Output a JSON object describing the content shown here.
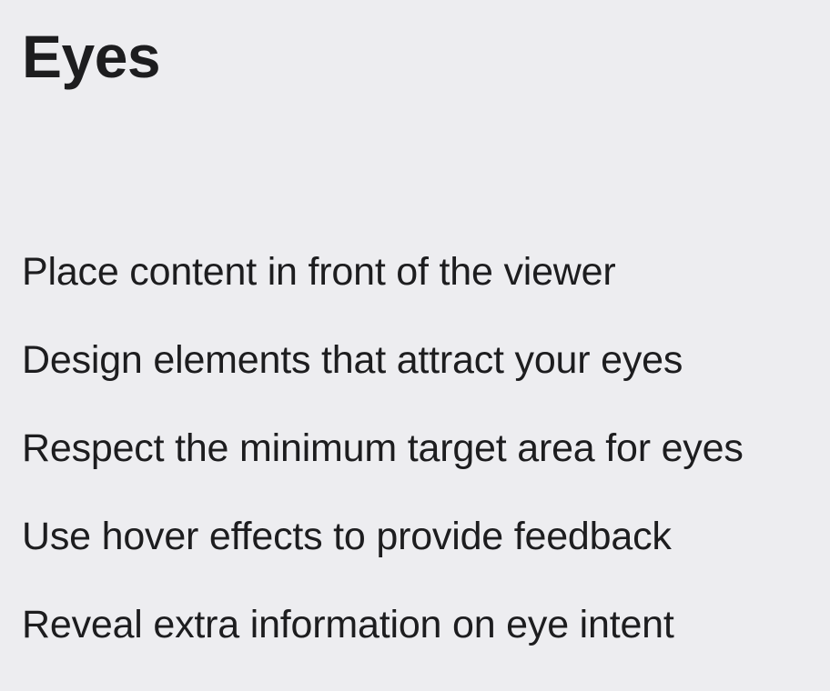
{
  "page": {
    "title": "Eyes",
    "items": [
      "Place content in front of the viewer",
      "Design elements that attract your eyes",
      "Respect the minimum target area for eyes",
      "Use hover effects to provide feedback",
      "Reveal extra information on eye intent"
    ]
  },
  "colors": {
    "background": "#ededf0",
    "text": "#1d1d1f"
  }
}
